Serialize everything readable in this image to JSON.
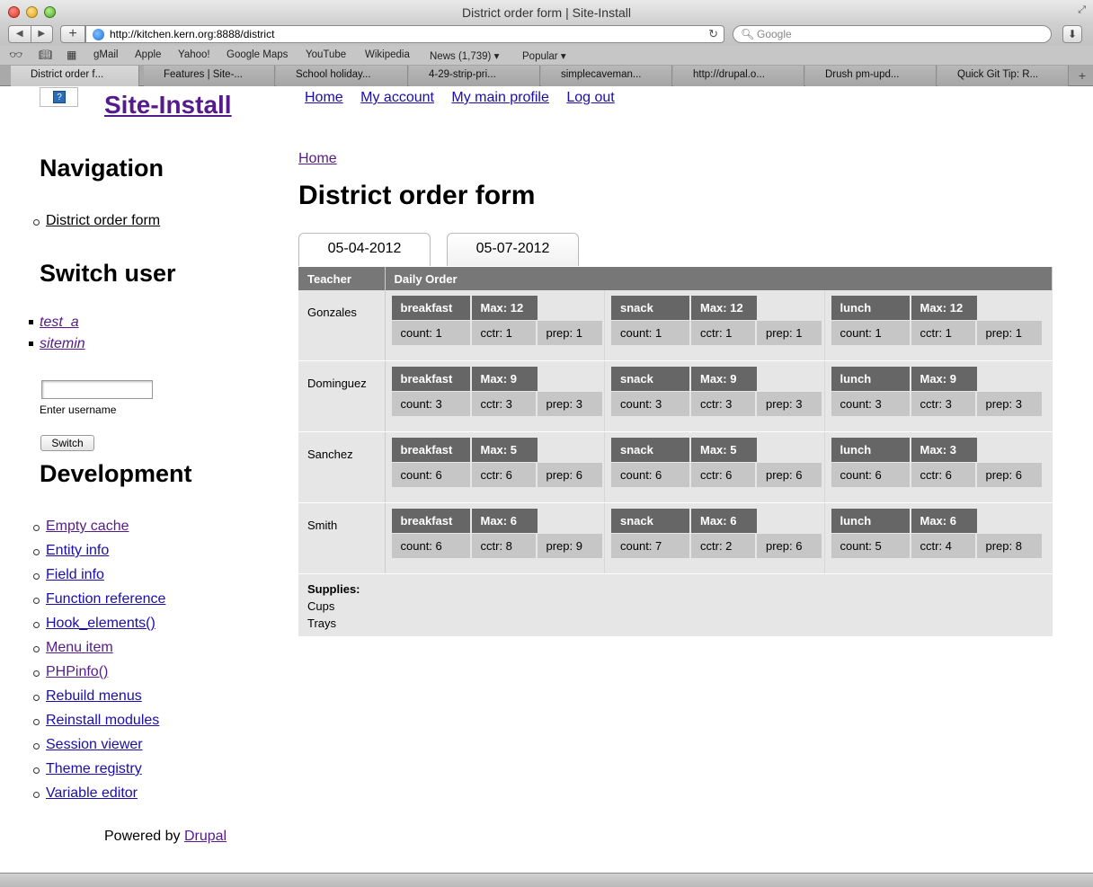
{
  "browser": {
    "window_title": "District order form | Site-Install",
    "url": "http://kitchen.kern.org:8888/district",
    "search_placeholder": "Google",
    "bookmarks": [
      "gMail",
      "Apple",
      "Yahoo!",
      "Google Maps",
      "YouTube",
      "Wikipedia",
      "News (1,739) ▾",
      "Popular ▾"
    ],
    "tabs": [
      "District order f...",
      "Features | Site-...",
      "School holiday...",
      "4-29-strip-pri...",
      "simplecaveman...",
      "http://drupal.o...",
      "Drush pm-upd...",
      "Quick Git Tip: R..."
    ]
  },
  "site": {
    "name": "Site-Install",
    "top_nav": [
      "Home",
      "My account",
      "My main profile",
      "Log out"
    ]
  },
  "sidebar": {
    "navigation_title": "Navigation",
    "navigation_items": [
      "District order form"
    ],
    "switch_user_title": "Switch user",
    "switch_user_items": [
      "test_a",
      "sitemin"
    ],
    "username_description": "Enter username",
    "switch_button": "Switch",
    "development_title": "Development",
    "development_items": [
      "Empty cache",
      "Entity info",
      "Field info",
      "Function reference",
      "Hook_elements()",
      "Menu item",
      "PHPinfo()",
      "Rebuild menus",
      "Reinstall modules",
      "Session viewer",
      "Theme registry",
      "Variable editor"
    ],
    "powered_by": "Powered by",
    "powered_link": "Drupal"
  },
  "main": {
    "breadcrumb": "Home",
    "title": "District order form",
    "date_tabs": [
      "05-04-2012",
      "05-07-2012"
    ],
    "table_headers": [
      "Teacher",
      "Daily Order"
    ],
    "rows": [
      {
        "teacher": "Gonzales",
        "meals": [
          {
            "name": "breakfast",
            "max": "Max: 12",
            "count": "count: 1",
            "cctr": "cctr: 1",
            "prep": "prep: 1"
          },
          {
            "name": "snack",
            "max": "Max: 12",
            "count": "count: 1",
            "cctr": "cctr: 1",
            "prep": "prep: 1"
          },
          {
            "name": "lunch",
            "max": "Max: 12",
            "count": "count: 1",
            "cctr": "cctr: 1",
            "prep": "prep: 1"
          }
        ]
      },
      {
        "teacher": "Dominguez",
        "meals": [
          {
            "name": "breakfast",
            "max": "Max: 9",
            "count": "count: 3",
            "cctr": "cctr: 3",
            "prep": "prep: 3"
          },
          {
            "name": "snack",
            "max": "Max: 9",
            "count": "count: 3",
            "cctr": "cctr: 3",
            "prep": "prep: 3"
          },
          {
            "name": "lunch",
            "max": "Max: 9",
            "count": "count: 3",
            "cctr": "cctr: 3",
            "prep": "prep: 3"
          }
        ]
      },
      {
        "teacher": "Sanchez",
        "meals": [
          {
            "name": "breakfast",
            "max": "Max: 5",
            "count": "count: 6",
            "cctr": "cctr: 6",
            "prep": "prep: 6"
          },
          {
            "name": "snack",
            "max": "Max: 5",
            "count": "count: 6",
            "cctr": "cctr: 6",
            "prep": "prep: 6"
          },
          {
            "name": "lunch",
            "max": "Max: 3",
            "count": "count: 6",
            "cctr": "cctr: 6",
            "prep": "prep: 6"
          }
        ]
      },
      {
        "teacher": "Smith",
        "meals": [
          {
            "name": "breakfast",
            "max": "Max: 6",
            "count": "count: 6",
            "cctr": "cctr: 8",
            "prep": "prep: 9"
          },
          {
            "name": "snack",
            "max": "Max: 6",
            "count": "count: 7",
            "cctr": "cctr: 2",
            "prep": "prep: 6"
          },
          {
            "name": "lunch",
            "max": "Max: 6",
            "count": "count: 5",
            "cctr": "cctr: 4",
            "prep": "prep: 8"
          }
        ]
      }
    ],
    "supplies_title": "Supplies:",
    "supplies": [
      "Cups",
      "Trays"
    ]
  }
}
